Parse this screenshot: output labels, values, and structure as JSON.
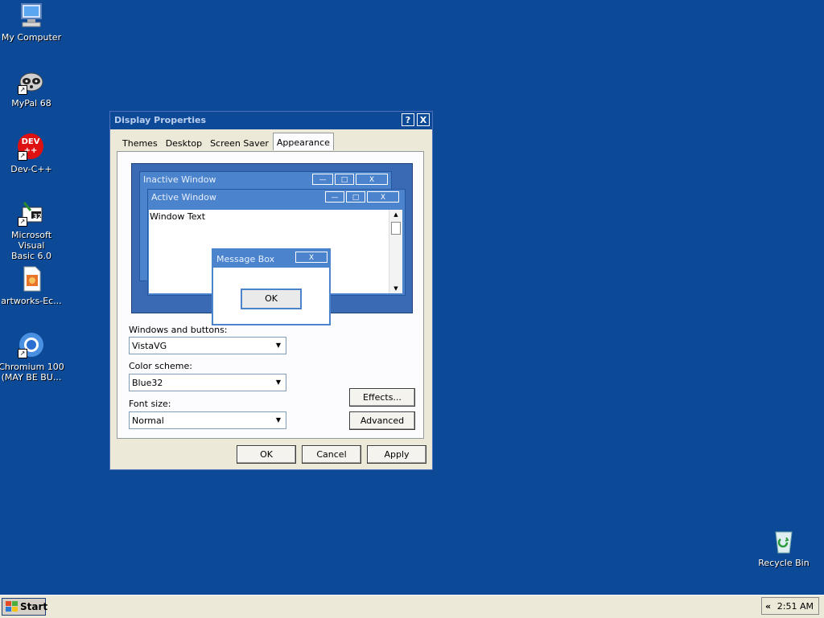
{
  "desktop": {
    "icons": [
      {
        "label": "My Computer"
      },
      {
        "label": "MyPal 68"
      },
      {
        "label": "Dev-C++"
      },
      {
        "label": "Microsoft Visual\nBasic 6.0"
      },
      {
        "label": "artworks-Ec..."
      },
      {
        "label": "Chromium 100\n(MAY BE BU..."
      },
      {
        "label": "Recycle Bin"
      }
    ],
    "devcpp_badge": "DEV\n++",
    "vb_badge": "32"
  },
  "dialog": {
    "title": "Display Properties",
    "help_btn": "?",
    "close_btn": "X",
    "tabs": [
      "Themes",
      "Desktop",
      "Screen Saver",
      "Appearance"
    ],
    "preview": {
      "inactive_title": "Inactive Window",
      "active_title": "Active Window",
      "window_text": "Window Text",
      "message_box_title": "Message Box",
      "ok": "OK",
      "min": "—",
      "max": "□",
      "close": "X"
    },
    "windows_buttons_label": "Windows and buttons:",
    "windows_buttons_value": "VistaVG",
    "color_scheme_label": "Color scheme:",
    "color_scheme_value": "Blue32",
    "font_size_label": "Font size:",
    "font_size_value": "Normal",
    "effects_btn": "Effects...",
    "advanced_btn": "Advanced",
    "ok_btn": "OK",
    "cancel_btn": "Cancel",
    "apply_btn": "Apply"
  },
  "taskbar": {
    "start": "Start",
    "tray_arrow": "«",
    "clock": "2:51 AM"
  },
  "colors": {
    "desktop_bg": "#0c4a97",
    "dialog_bg": "#ece9d8",
    "preview_title": "#4b83cd"
  }
}
